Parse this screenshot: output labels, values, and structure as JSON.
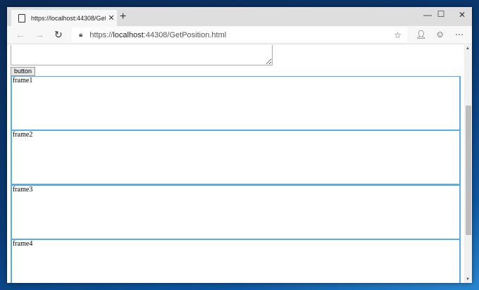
{
  "browser": {
    "tab_title": "https://localhost:44308/GetPosition.html",
    "url_prefix": "https://",
    "url_host": "localhost",
    "url_rest": ":44308/GetPosition.html"
  },
  "page": {
    "button_label": "button",
    "textarea_value": "",
    "frames": [
      "frame1",
      "frame2",
      "frame3",
      "frame4"
    ]
  }
}
